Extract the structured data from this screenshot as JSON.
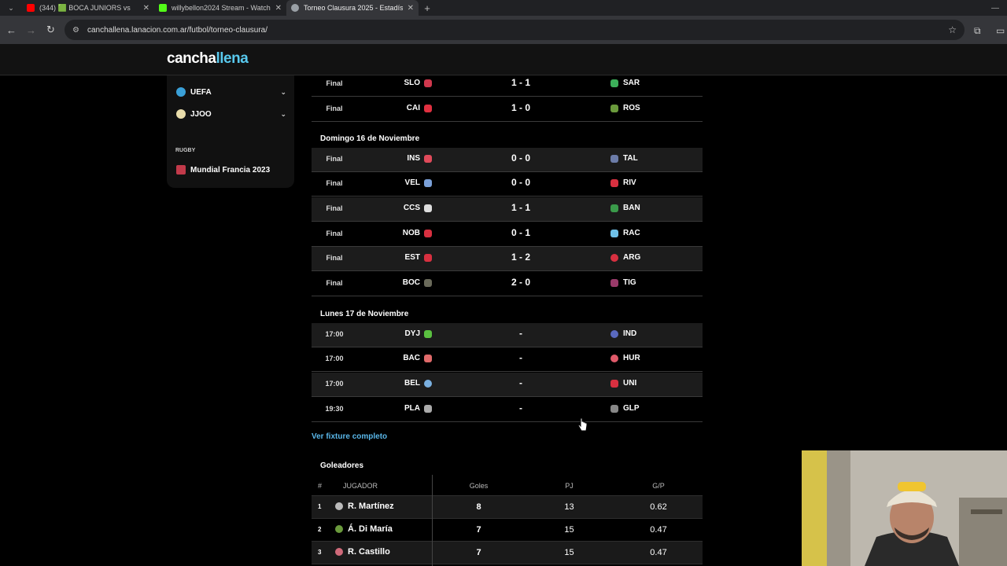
{
  "browser": {
    "tabs": [
      {
        "title": "(344) 🟩 BOCA JUNIORS vs",
        "color": "#ff0000",
        "active": false
      },
      {
        "title": "willybellon2024 Stream - Watch",
        "color": "#53fc18",
        "active": false
      },
      {
        "title": "Torneo Clausura 2025 - Estadís",
        "color": "#9aa0a6",
        "active": true
      }
    ],
    "url": "canchallena.lanacion.com.ar/futbol/torneo-clausura/"
  },
  "site": {
    "logo_main": "cancha",
    "logo_accent": "llena"
  },
  "sidebar": {
    "items": [
      {
        "label": "UEFA",
        "color": "#3aa0d8"
      },
      {
        "label": "JJOO",
        "color": "#e8dcaa"
      }
    ],
    "category": "RUGBY",
    "rugby_item": {
      "label": "Mundial Francia 2023",
      "color": "#c23a4a"
    }
  },
  "fixture": {
    "day_headers": [
      "Domingo 16 de Noviembre",
      "Lunes 17 de Noviembre"
    ],
    "matches": [
      {
        "status": "Final",
        "home": "SLO",
        "score": "1 - 1",
        "away": "SAR",
        "hc": "#d0384d",
        "ac": "#3cb05a"
      },
      {
        "status": "Final",
        "home": "CAI",
        "score": "1 - 0",
        "away": "ROS",
        "hc": "#e03040",
        "ac": "#6a9a3c"
      },
      {
        "status": "Final",
        "home": "INS",
        "score": "0 - 0",
        "away": "TAL",
        "hc": "#e04a5a",
        "ac": "#6c7ca8"
      },
      {
        "status": "Final",
        "home": "VEL",
        "score": "0 - 0",
        "away": "RIV",
        "hc": "#7aa0d8",
        "ac": "#d83040"
      },
      {
        "status": "Final",
        "home": "CCS",
        "score": "1 - 1",
        "away": "BAN",
        "hc": "#dddddd",
        "ac": "#3a9a4a"
      },
      {
        "status": "Final",
        "home": "NOB",
        "score": "0 - 1",
        "away": "RAC",
        "hc": "#d83040",
        "ac": "#6ec0e8"
      },
      {
        "status": "Final",
        "home": "EST",
        "score": "1 - 2",
        "away": "ARG",
        "hc": "#d83040",
        "ac": "#d83040"
      },
      {
        "status": "Final",
        "home": "BOC",
        "score": "2 - 0",
        "away": "TIG",
        "hc": "#6a6a5a",
        "ac": "#9a3a6a"
      },
      {
        "status": "17:00",
        "home": "DYJ",
        "score": "-",
        "away": "IND",
        "hc": "#5ac040",
        "ac": "#5a6ac0"
      },
      {
        "status": "17:00",
        "home": "BAC",
        "score": "-",
        "away": "HUR",
        "hc": "#e06a6a",
        "ac": "#e05a6a"
      },
      {
        "status": "17:00",
        "home": "BEL",
        "score": "-",
        "away": "UNI",
        "hc": "#7ab0e0",
        "ac": "#d83040"
      },
      {
        "status": "19:30",
        "home": "PLA",
        "score": "-",
        "away": "GLP",
        "hc": "#aaaaaa",
        "ac": "#888888"
      }
    ],
    "link": "Ver fixture completo"
  },
  "scorers": {
    "title": "Goleadores",
    "headers": [
      "#",
      "JUGADOR",
      "Goles",
      "PJ",
      "G/P"
    ],
    "rows": [
      {
        "n": "1",
        "player": "R. Martínez",
        "goals": "8",
        "pj": "13",
        "gp": "0.62",
        "color": "#bbbbbb"
      },
      {
        "n": "2",
        "player": "Á. Di María",
        "goals": "7",
        "pj": "15",
        "gp": "0.47",
        "color": "#6a9a3c"
      },
      {
        "n": "3",
        "player": "R. Castillo",
        "goals": "7",
        "pj": "15",
        "gp": "0.47",
        "color": "#d06a7a"
      }
    ]
  }
}
